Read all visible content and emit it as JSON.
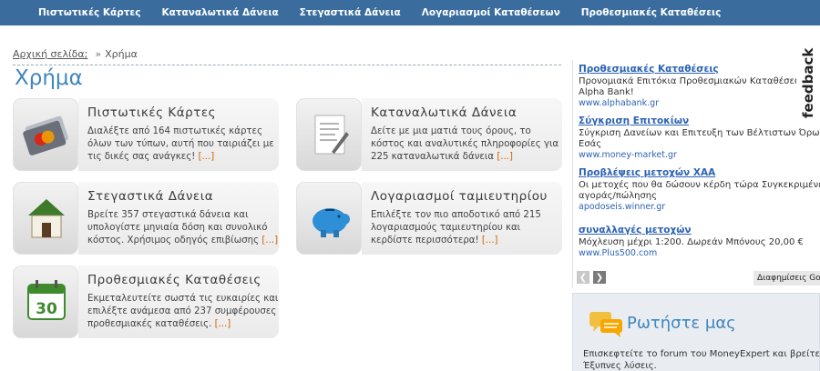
{
  "nav": [
    "Πιστωτικές Κάρτες",
    "Καταναλωτικά Δάνεια",
    "Στεγαστικά Δάνεια",
    "Λογαριασμοί Καταθέσεων",
    "Προθεσμιακές Καταθέσεις"
  ],
  "breadcrumb": {
    "home": "Αρχική σελίδα;",
    "sep": "»",
    "current": "Χρήμα"
  },
  "page_title": "Χρήμα",
  "cards": [
    {
      "title": "Πιστωτικές Κάρτες",
      "text": "Διαλέξτε από 164 πιστωτικές κάρτες όλων των τύπων, αυτή που ταιριάζει με τις δικές σας ανάγκες!",
      "more": "[...]",
      "icon": "credit-card-icon"
    },
    {
      "title": "Καταναλωτικά Δάνεια",
      "text": "Δείτε με μια ματιά τους όρους, το κόστος και αναλυτικές πληροφορίες για 225 καταναλωτικά δάνεια",
      "more": "[...]",
      "icon": "document-icon"
    },
    {
      "title": "Στεγαστικά Δάνεια",
      "text": "Βρείτε 357 στεγαστικά δάνεια και υπολογίστε μηνιαία δόση και συνολικό κόστος. Χρήσιμος οδηγός επιβίωσης",
      "more": "[...]",
      "icon": "house-icon"
    },
    {
      "title": "Λογαριασμοί ταμιευτηρίου",
      "text": "Επιλέξτε τον πιο αποδοτικό από 215 λογαριασμούς ταμιευτηρίου και κερδίστε περισσότερα!",
      "more": "[...]",
      "icon": "piggy-bank-icon"
    },
    {
      "title": "Προθεσμιακές Καταθέσεις",
      "text": "Εκμεταλευτείτε σωστά τις ευκαιρίες και επιλέξτε ανάμεσα από 237 συμφέρουσες προθεσμιακές καταθέσεις.",
      "more": "[...]",
      "icon": "calendar-icon",
      "calendar_day": "30"
    }
  ],
  "ads": [
    {
      "title": "Προθεσμιακές Καταθέσεις",
      "body": [
        "Προνομιακά Επιτόκια Προθεσμιακών Καταθέσεων",
        "Alpha Bank!"
      ],
      "url": "www.alphabank.gr"
    },
    {
      "title": "Σύγκριση Επιτοκίων",
      "body": [
        "Σύγκριση Δανείων και Επιτευξη των Βέλτιστων Όρων για",
        "Εσάς"
      ],
      "url": "www.money-market.gr"
    },
    {
      "title": "Προβλέψεις μετοχών ΧΑΑ",
      "body": [
        "Οι μετοχές που θα δώσουν κέρδη τώρα Συγκεκριμένες",
        "αγοράς/πώλησης"
      ],
      "url": "apodoseis.winner.gr"
    },
    {
      "title": "συναλλαγές μετοχών",
      "body": [
        "Μόχλευση μέχρι 1:200. Δωρεάν Μπόνους 20,00 €"
      ],
      "url": "www.Plus500.com"
    }
  ],
  "ads_by": "Διαφημίσεις Go",
  "feedback": "feedback",
  "ask": {
    "title": "Ρωτήστε μας",
    "text": [
      "Επισκεφτείτε το forum του MoneyExpert και βρείτε:",
      "Έξυπνες λύσεις."
    ]
  }
}
